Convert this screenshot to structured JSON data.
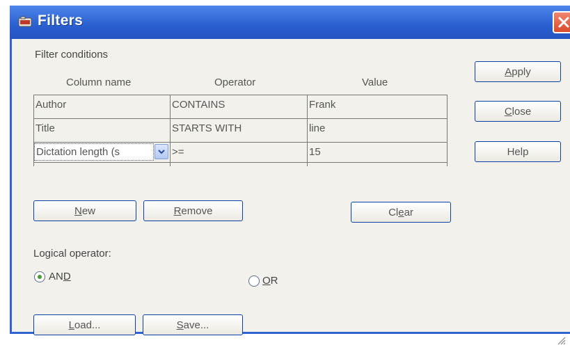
{
  "window": {
    "title": "Filters",
    "accent": "#2a5fcf"
  },
  "filter_conditions_label": "Filter conditions",
  "grid": {
    "columns": [
      "Column name",
      "Operator",
      "Value"
    ],
    "rows": [
      {
        "column": "Author",
        "operator": "CONTAINS",
        "value": "Frank"
      },
      {
        "column": "Title",
        "operator": "STARTS WITH",
        "value": "line"
      },
      {
        "column": "Dictation length (s",
        "operator": ">=",
        "value": "15"
      }
    ]
  },
  "buttons": {
    "apply": {
      "prefix": "",
      "u": "A",
      "rest": "pply"
    },
    "close": {
      "prefix": "",
      "u": "C",
      "rest": "lose"
    },
    "help": {
      "prefix": "",
      "u": "",
      "rest": "Help"
    },
    "new": {
      "prefix": "",
      "u": "N",
      "rest": "ew"
    },
    "remove": {
      "prefix": "",
      "u": "R",
      "rest": "emove"
    },
    "clear": {
      "prefix": "Cl",
      "u": "e",
      "rest": "ar"
    },
    "load": {
      "prefix": "",
      "u": "L",
      "rest": "oad..."
    },
    "save": {
      "prefix": "",
      "u": "S",
      "rest": "ave..."
    }
  },
  "logical_operator": {
    "label": "Logical operator:",
    "and": {
      "prefix": "AN",
      "u": "D",
      "rest": ""
    },
    "or": {
      "prefix": "",
      "u": "O",
      "rest": "R"
    },
    "selected": "AND"
  }
}
